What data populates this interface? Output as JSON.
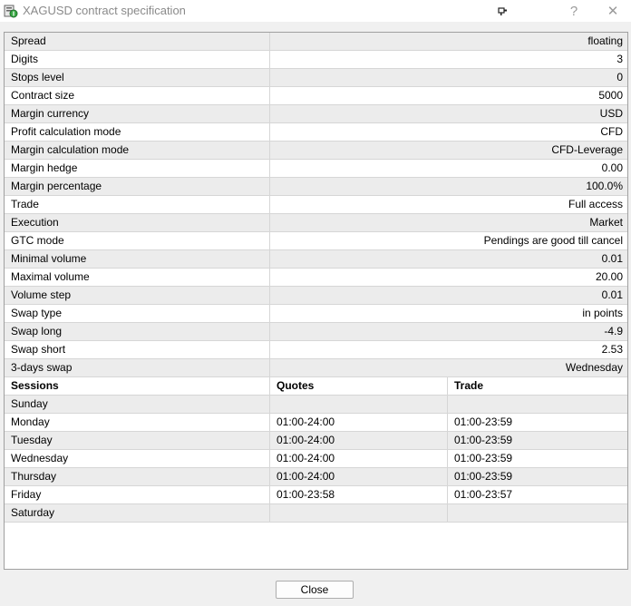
{
  "window": {
    "title": "XAGUSD contract specification",
    "help_glyph": "?",
    "close_glyph": "✕"
  },
  "spec_rows": [
    {
      "label": "Spread",
      "value": "floating"
    },
    {
      "label": "Digits",
      "value": "3"
    },
    {
      "label": "Stops level",
      "value": "0"
    },
    {
      "label": "Contract size",
      "value": "5000"
    },
    {
      "label": "Margin currency",
      "value": "USD"
    },
    {
      "label": "Profit calculation mode",
      "value": "CFD"
    },
    {
      "label": "Margin calculation mode",
      "value": "CFD-Leverage"
    },
    {
      "label": "Margin hedge",
      "value": "0.00"
    },
    {
      "label": "Margin percentage",
      "value": "100.0%"
    },
    {
      "label": "Trade",
      "value": "Full access"
    },
    {
      "label": "Execution",
      "value": "Market"
    },
    {
      "label": "GTC mode",
      "value": "Pendings are good till cancel"
    },
    {
      "label": "Minimal volume",
      "value": "0.01"
    },
    {
      "label": "Maximal volume",
      "value": "20.00"
    },
    {
      "label": "Volume step",
      "value": "0.01"
    },
    {
      "label": "Swap type",
      "value": "in points"
    },
    {
      "label": "Swap long",
      "value": "-4.9"
    },
    {
      "label": "Swap short",
      "value": "2.53"
    },
    {
      "label": "3-days swap",
      "value": "Wednesday"
    }
  ],
  "sessions": {
    "headers": {
      "day": "Sessions",
      "quotes": "Quotes",
      "trade": "Trade"
    },
    "rows": [
      {
        "day": "Sunday",
        "quotes": "",
        "trade": ""
      },
      {
        "day": "Monday",
        "quotes": "01:00-24:00",
        "trade": "01:00-23:59"
      },
      {
        "day": "Tuesday",
        "quotes": "01:00-24:00",
        "trade": "01:00-23:59"
      },
      {
        "day": "Wednesday",
        "quotes": "01:00-24:00",
        "trade": "01:00-23:59"
      },
      {
        "day": "Thursday",
        "quotes": "01:00-24:00",
        "trade": "01:00-23:59"
      },
      {
        "day": "Friday",
        "quotes": "01:00-23:58",
        "trade": "01:00-23:57"
      },
      {
        "day": "Saturday",
        "quotes": "",
        "trade": ""
      }
    ]
  },
  "footer": {
    "close_label": "Close"
  },
  "colors": {
    "alt_row": "#ececec",
    "grid": "#d6d6d6",
    "border": "#a0a0a0"
  }
}
